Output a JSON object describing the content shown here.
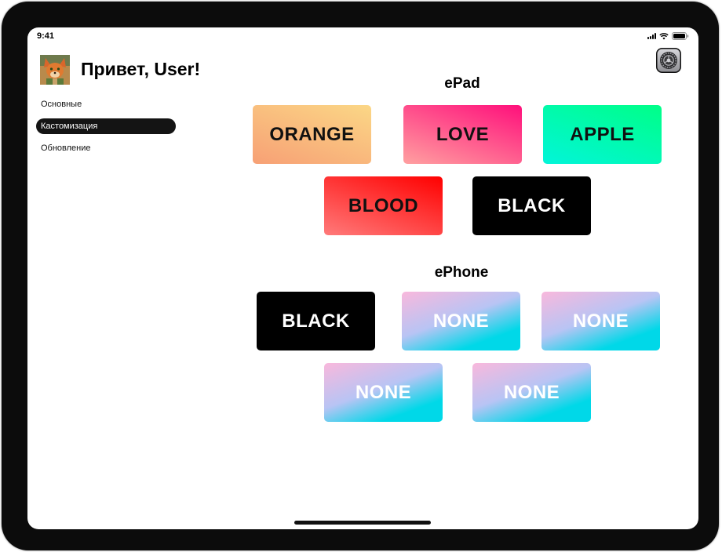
{
  "status_bar": {
    "time": "9:41"
  },
  "header": {
    "greeting": "Привет, User!"
  },
  "sidebar": {
    "items": [
      {
        "label": "Основные",
        "active": false
      },
      {
        "label": "Кастомизация",
        "active": true
      },
      {
        "label": "Обновление",
        "active": false
      }
    ]
  },
  "sections": {
    "epad": {
      "title": "ePad",
      "themes": [
        {
          "label": "ORANGE",
          "colors": [
            "#fbd786",
            "#f7a075"
          ]
        },
        {
          "label": "LOVE",
          "colors": [
            "#ff0f7b",
            "#ffa0a0"
          ]
        },
        {
          "label": "APPLE",
          "colors": [
            "#00ff87",
            "#02f5d9"
          ]
        },
        {
          "label": "BLOOD",
          "colors": [
            "#ff0000",
            "#ff7a7a"
          ]
        },
        {
          "label": "BLACK",
          "colors": [
            "#000000",
            "#000000"
          ]
        }
      ]
    },
    "ephone": {
      "title": "ePhone",
      "themes": [
        {
          "label": "BLACK",
          "colors": [
            "#000000",
            "#000000"
          ]
        },
        {
          "label": "NONE",
          "colors": [
            "#00d8e8",
            "#f9b8dc"
          ]
        },
        {
          "label": "NONE",
          "colors": [
            "#00d8e8",
            "#f9b8dc"
          ]
        },
        {
          "label": "NONE",
          "colors": [
            "#00d8e8",
            "#f9b8dc"
          ]
        },
        {
          "label": "NONE",
          "colors": [
            "#00d8e8",
            "#f9b8dc"
          ]
        }
      ]
    }
  },
  "colors": {
    "accent_dark": "#141414",
    "tile_text_dark": "#111111",
    "tile_text_light": "#ffffff"
  },
  "icons": {
    "settings": "gear-icon",
    "signal": "signal-icon",
    "wifi": "wifi-icon",
    "battery": "battery-icon",
    "avatar": "avatar-fox-image"
  }
}
